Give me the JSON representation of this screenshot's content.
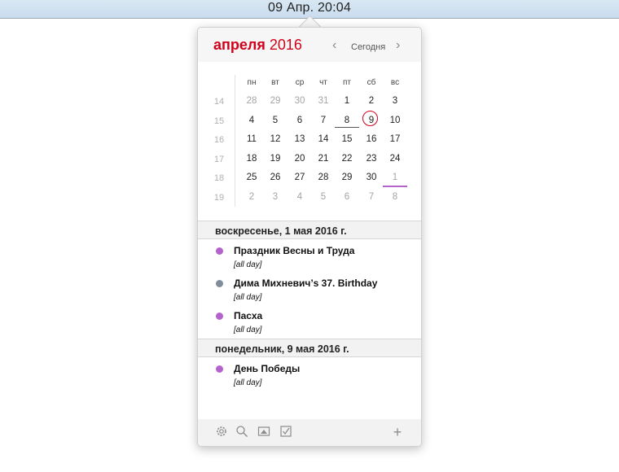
{
  "menubar": {
    "clock": "09 Апр. 20:04"
  },
  "header": {
    "month": "апреля",
    "year": "2016",
    "today_label": "Сегодня",
    "prev_glyph": "‹",
    "next_glyph": "›"
  },
  "calendar": {
    "weekday_headers": [
      "пн",
      "вт",
      "ср",
      "чт",
      "пт",
      "сб",
      "вс"
    ],
    "week_numbers": [
      "14",
      "15",
      "16",
      "17",
      "18",
      "19"
    ],
    "weeks": [
      [
        "28",
        "29",
        "30",
        "31",
        "1",
        "2",
        "3"
      ],
      [
        "4",
        "5",
        "6",
        "7",
        "8",
        "9",
        "10"
      ],
      [
        "11",
        "12",
        "13",
        "14",
        "15",
        "16",
        "17"
      ],
      [
        "18",
        "19",
        "20",
        "21",
        "22",
        "23",
        "24"
      ],
      [
        "25",
        "26",
        "27",
        "28",
        "29",
        "30",
        "1"
      ],
      [
        "2",
        "3",
        "4",
        "5",
        "6",
        "7",
        "8"
      ]
    ],
    "selected_day": "9"
  },
  "agenda": [
    {
      "date_label": "воскресенье, 1 мая 2016 г.",
      "events": [
        {
          "title": "Праздник Весны и Труда",
          "time": "[all day]",
          "color": "#b662cc"
        },
        {
          "title": "Дима Михневич’s 37. Birthday",
          "time": "[all day]",
          "color": "#7f8c9c"
        },
        {
          "title": "Пасха",
          "time": "[all day]",
          "color": "#b662cc"
        }
      ]
    },
    {
      "date_label": "понедельник, 9 мая 2016 г.",
      "events": [
        {
          "title": "День Победы",
          "time": "[all day]",
          "color": "#b662cc"
        }
      ]
    }
  ],
  "footer": {
    "icons": [
      "gear-icon",
      "search-icon",
      "image-icon",
      "checkbox-icon",
      "plus-icon"
    ],
    "plus_glyph": "+"
  },
  "colors": {
    "accent": "#d0021b",
    "event_purple": "#b662cc",
    "event_grey": "#7f8c9c"
  }
}
